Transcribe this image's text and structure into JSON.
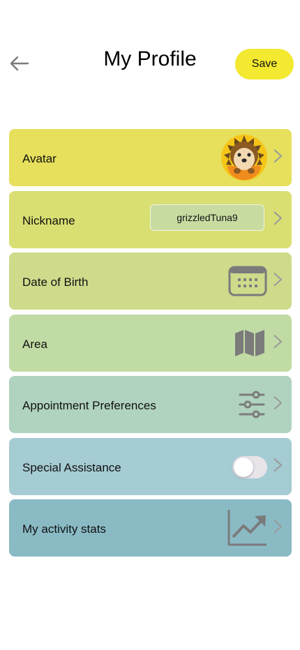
{
  "header": {
    "title": "My Profile",
    "save_label": "Save",
    "back_icon": "arrow-left-icon"
  },
  "items": [
    {
      "label": "Avatar",
      "bg": "#e6e05c",
      "trailing": "hedgehog-avatar-icon"
    },
    {
      "label": "Nickname",
      "bg": "#d9df72",
      "trailing": "nickname-value",
      "value": "grizzledTuna9"
    },
    {
      "label": "Date of Birth",
      "bg": "#cfdb8b",
      "trailing": "calendar-icon"
    },
    {
      "label": "Area",
      "bg": "#c1dba4",
      "trailing": "map-icon"
    },
    {
      "label": "Appointment Preferences",
      "bg": "#b0d3bf",
      "trailing": "sliders-icon"
    },
    {
      "label": "Special Assistance",
      "bg": "#a5cbd3",
      "trailing": "toggle",
      "toggle_on": false
    },
    {
      "label": "My activity stats",
      "bg": "#8abbc5",
      "trailing": "trending-up-icon"
    }
  ],
  "colors": {
    "save_button": "#f2e930",
    "icon_gray": "#7b7b7b",
    "chevron_gray": "#9a9a9a"
  }
}
